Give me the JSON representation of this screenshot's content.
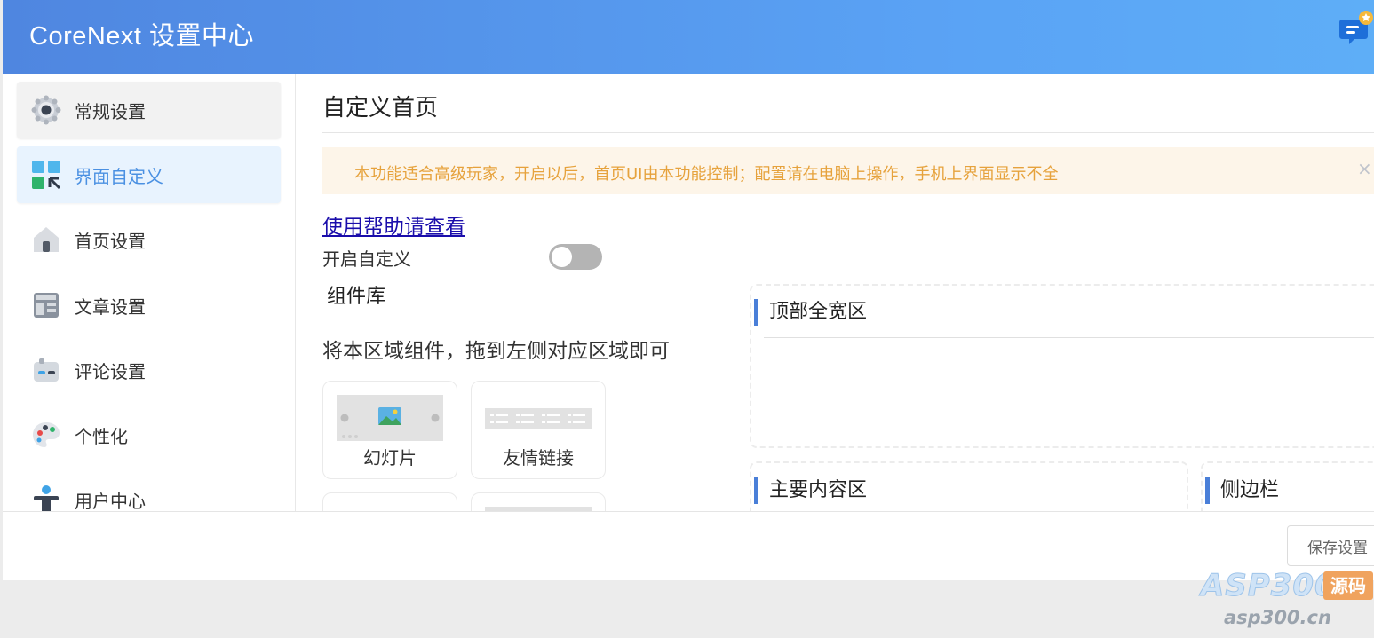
{
  "header": {
    "title": "CoreNext 设置中心",
    "notification_icon": "message-icon"
  },
  "sidebar": {
    "items": [
      {
        "label": "常规设置",
        "icon": "gear-icon",
        "state": "hover"
      },
      {
        "label": "界面自定义",
        "icon": "layout-icon",
        "state": "active"
      },
      {
        "label": "首页设置",
        "icon": "home-icon",
        "state": "normal"
      },
      {
        "label": "文章设置",
        "icon": "article-icon",
        "state": "normal"
      },
      {
        "label": "评论设置",
        "icon": "comment-icon",
        "state": "normal"
      },
      {
        "label": "个性化",
        "icon": "palette-icon",
        "state": "normal"
      },
      {
        "label": "用户中心",
        "icon": "user-icon",
        "state": "normal"
      }
    ]
  },
  "main": {
    "title": "自定义首页",
    "alert": {
      "text": "本功能适合高级玩家，开启以后，首页UI由本功能控制；配置请在电脑上操作，手机上界面显示不全",
      "close": "×"
    },
    "help_link": "使用帮助请查看",
    "toggle": {
      "label": "开启自定义",
      "enabled": false
    },
    "library": {
      "title": "组件库",
      "hint": "将本区域组件，拖到左侧对应区域即可",
      "components": [
        {
          "label": "幻灯片",
          "icon": "slideshow-icon"
        },
        {
          "label": "友情链接",
          "icon": "links-icon"
        }
      ]
    },
    "zones": {
      "top_full": "顶部全宽区",
      "main_content": "主要内容区",
      "sidebar": "侧边栏"
    }
  },
  "footer": {
    "save_label": "保存设置"
  },
  "watermark": {
    "brand": "ASP300",
    "tag": "源码",
    "url": "asp300.cn"
  },
  "colors": {
    "accent": "#4a90e2",
    "header_start": "#4f86e0",
    "header_end": "#5eaef7",
    "alert_bg": "#fdf5e9",
    "alert_text": "#e6a23c",
    "section_bar": "#4a7fd8"
  }
}
